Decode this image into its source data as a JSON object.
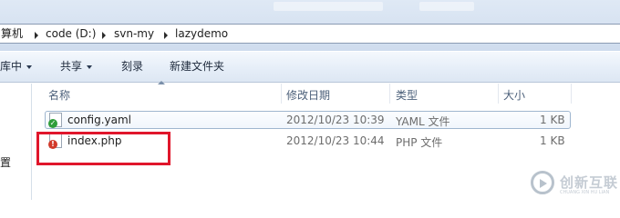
{
  "address": {
    "crumbs": [
      "算机",
      "code (D:)",
      "svn-my",
      "lazydemo"
    ]
  },
  "toolbar": {
    "include_library": "库中",
    "share": "共享",
    "burn": "刻录",
    "new_folder": "新建文件夹"
  },
  "navpane": {
    "partial_label": "置"
  },
  "columns": {
    "name": "名称",
    "modified": "修改日期",
    "type": "类型",
    "size": "大小"
  },
  "files": [
    {
      "name": "config.yaml",
      "modified": "2012/10/23 10:39",
      "type": "YAML 文件",
      "size": "1 KB",
      "status": "normal",
      "focused": true
    },
    {
      "name": "index.php",
      "modified": "2012/10/23 10:44",
      "type": "PHP 文件",
      "size": "1 KB",
      "status": "modified",
      "focused": false
    }
  ],
  "watermark": {
    "text": "创新互联",
    "subtext": "CHUANG XIN HU LIAN"
  },
  "colors": {
    "highlight": "#e0162b",
    "status_ok": "#2f9e3a",
    "status_modified": "#d23a2a"
  }
}
